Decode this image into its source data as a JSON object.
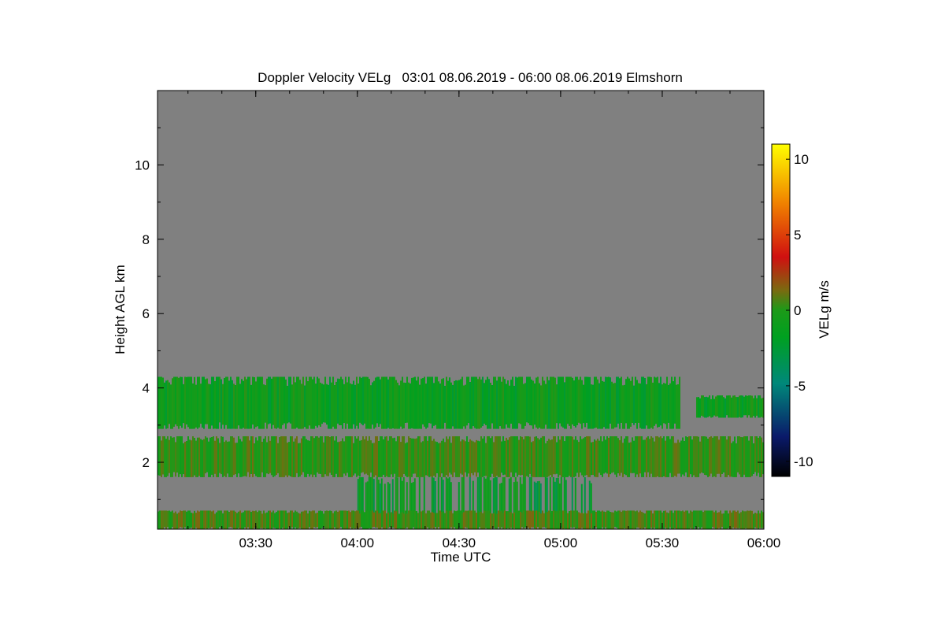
{
  "chart_data": {
    "type": "heatmap",
    "title": "Doppler Velocity VELg   03:01 08.06.2019 - 06:00 08.06.2019 Elmshorn",
    "xlabel": "Time UTC",
    "ylabel": "Height AGL km",
    "xlim": [
      "03:01",
      "06:00"
    ],
    "ylim": [
      0.2,
      12
    ],
    "xticks": [
      "03:30",
      "04:00",
      "04:30",
      "05:00",
      "05:30",
      "06:00"
    ],
    "yticks": [
      2,
      4,
      6,
      8,
      10
    ],
    "colorbar": {
      "label": "VELg m/s",
      "range": [
        -11,
        11
      ],
      "ticks": [
        10,
        5,
        0,
        -5,
        -10
      ],
      "colors": [
        "#000000",
        "#0a1a6a",
        "#00887a",
        "#00a020",
        "#1c9a18",
        "#7a6a10",
        "#d01010",
        "#f08000",
        "#ffff00"
      ]
    },
    "background_color": "#808080",
    "layers": [
      {
        "name": "upper cloud layer",
        "x_start": "03:01",
        "x_end": "05:35",
        "height_km": [
          2.9,
          4.3
        ],
        "velocity_ms": -1.5
      },
      {
        "name": "upper cloud layer (late)",
        "x_start": "05:40",
        "x_end": "06:00",
        "height_km": [
          3.2,
          3.8
        ],
        "velocity_ms": -1.5
      },
      {
        "name": "middle layer",
        "x_start": "03:01",
        "x_end": "06:00",
        "height_km": [
          1.6,
          2.7
        ],
        "velocity_ms": 0.5
      },
      {
        "name": "fall streaks",
        "x_start": "04:00",
        "x_end": "05:10",
        "height_km": [
          0.5,
          1.6
        ],
        "velocity_ms": -2.5
      },
      {
        "name": "boundary layer",
        "x_start": "03:01",
        "x_end": "06:00",
        "height_km": [
          0.2,
          0.7
        ],
        "velocity_ms": 1.0
      }
    ]
  }
}
